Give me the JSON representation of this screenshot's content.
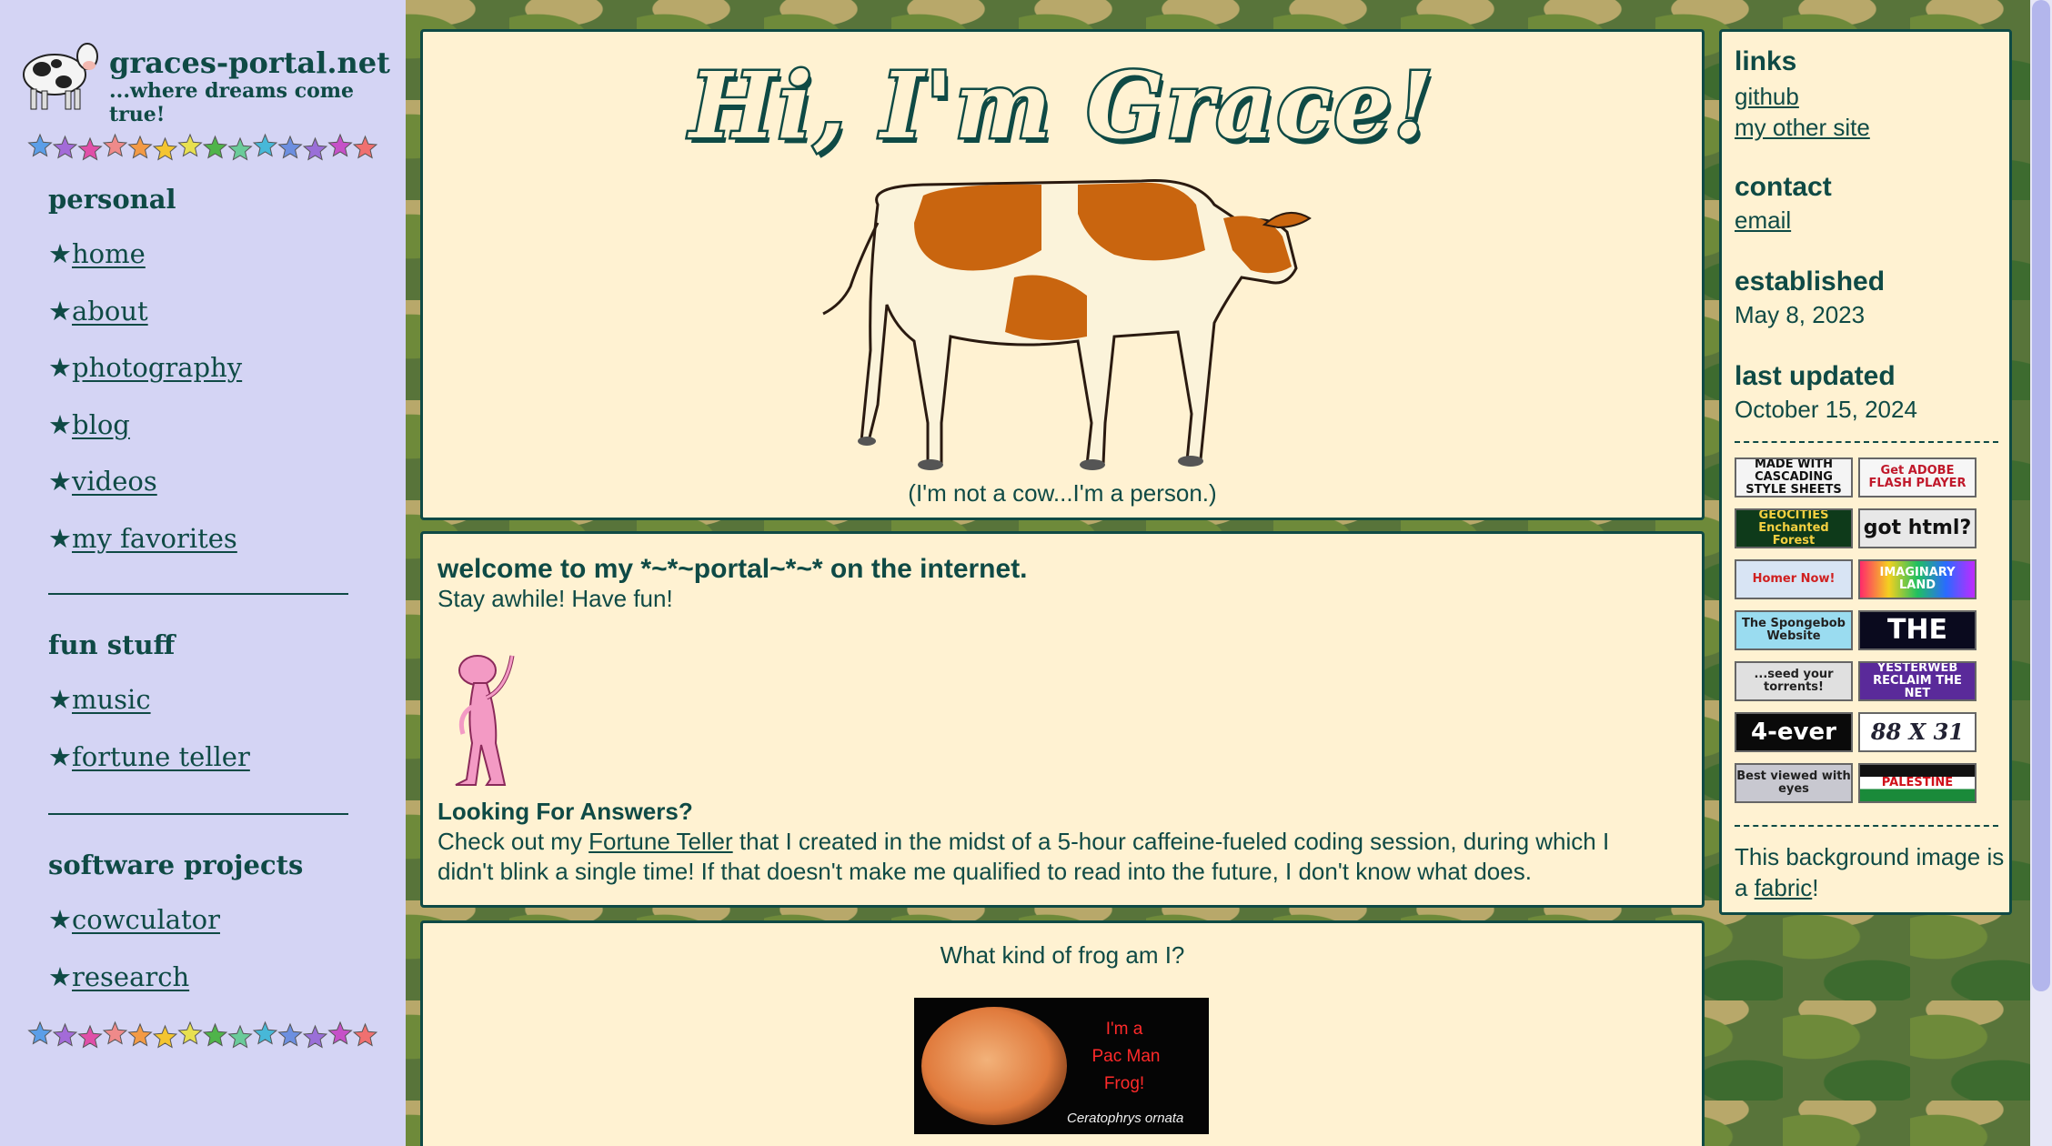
{
  "site": {
    "name": "graces-portal.net",
    "tagline": "...where dreams come true!"
  },
  "sidebar": {
    "star_glyph": "★",
    "sections": [
      {
        "title": "personal",
        "items": [
          "home",
          "about",
          "photography",
          "blog",
          "videos",
          "my favorites"
        ]
      },
      {
        "title": "fun stuff",
        "items": [
          "music",
          "fortune teller"
        ]
      },
      {
        "title": "software projects",
        "items": [
          "cowculator",
          "research"
        ]
      }
    ],
    "star_colors": [
      "#5b9ee8",
      "#a36bd8",
      "#e04fa8",
      "#ef8a8a",
      "#f39a45",
      "#f4c530",
      "#e8e050",
      "#4fb44a",
      "#6acb9a",
      "#47b8d8",
      "#6c8fe0",
      "#9a6fd8",
      "#c650c8",
      "#f07070"
    ]
  },
  "hero": {
    "title": "Hi, I'm Grace!",
    "caption": "(I'm not a cow...I'm a person.)"
  },
  "welcome": {
    "heading": "welcome to my *~*~portal~*~* on the internet.",
    "subtext": "Stay awhile! Have fun!",
    "answers_heading": "Looking For Answers?",
    "answers_before": "Check out my ",
    "answers_link": "Fortune Teller",
    "answers_after": " that I created in the midst of a 5-hour caffeine-fueled coding session, during which I didn't blink a single time! If that doesn't make me qualified to read into the future, I don't know what does."
  },
  "frog": {
    "title": "What kind of frog am I?",
    "line1": "I'm a",
    "line2": "Pac Man",
    "line3": "Frog!",
    "species": "Ceratophrys ornata"
  },
  "right": {
    "links_heading": "links",
    "link_github": "github",
    "link_other": "my other site",
    "contact_heading": "contact",
    "contact_email": "email",
    "established_heading": "established",
    "established_date": "May 8, 2023",
    "updated_heading": "last updated",
    "updated_date": "October 15, 2024",
    "badges": [
      "MADE WITH CASCADING STYLE SHEETS",
      "Get ADOBE FLASH PLAYER",
      "GEOCITIES Enchanted Forest",
      "got html?",
      "Homer Now!",
      "IMAGINARY LAND",
      "The Spongebob Website",
      "THE",
      "...seed your torrents!",
      "YESTERWEB RECLAIM THE NET",
      "4-ever",
      "88 X 31",
      "Best viewed with eyes",
      "PALESTINE"
    ],
    "bg_note_before": "This background image is a ",
    "bg_note_link": "fabric",
    "bg_note_after": "!"
  }
}
